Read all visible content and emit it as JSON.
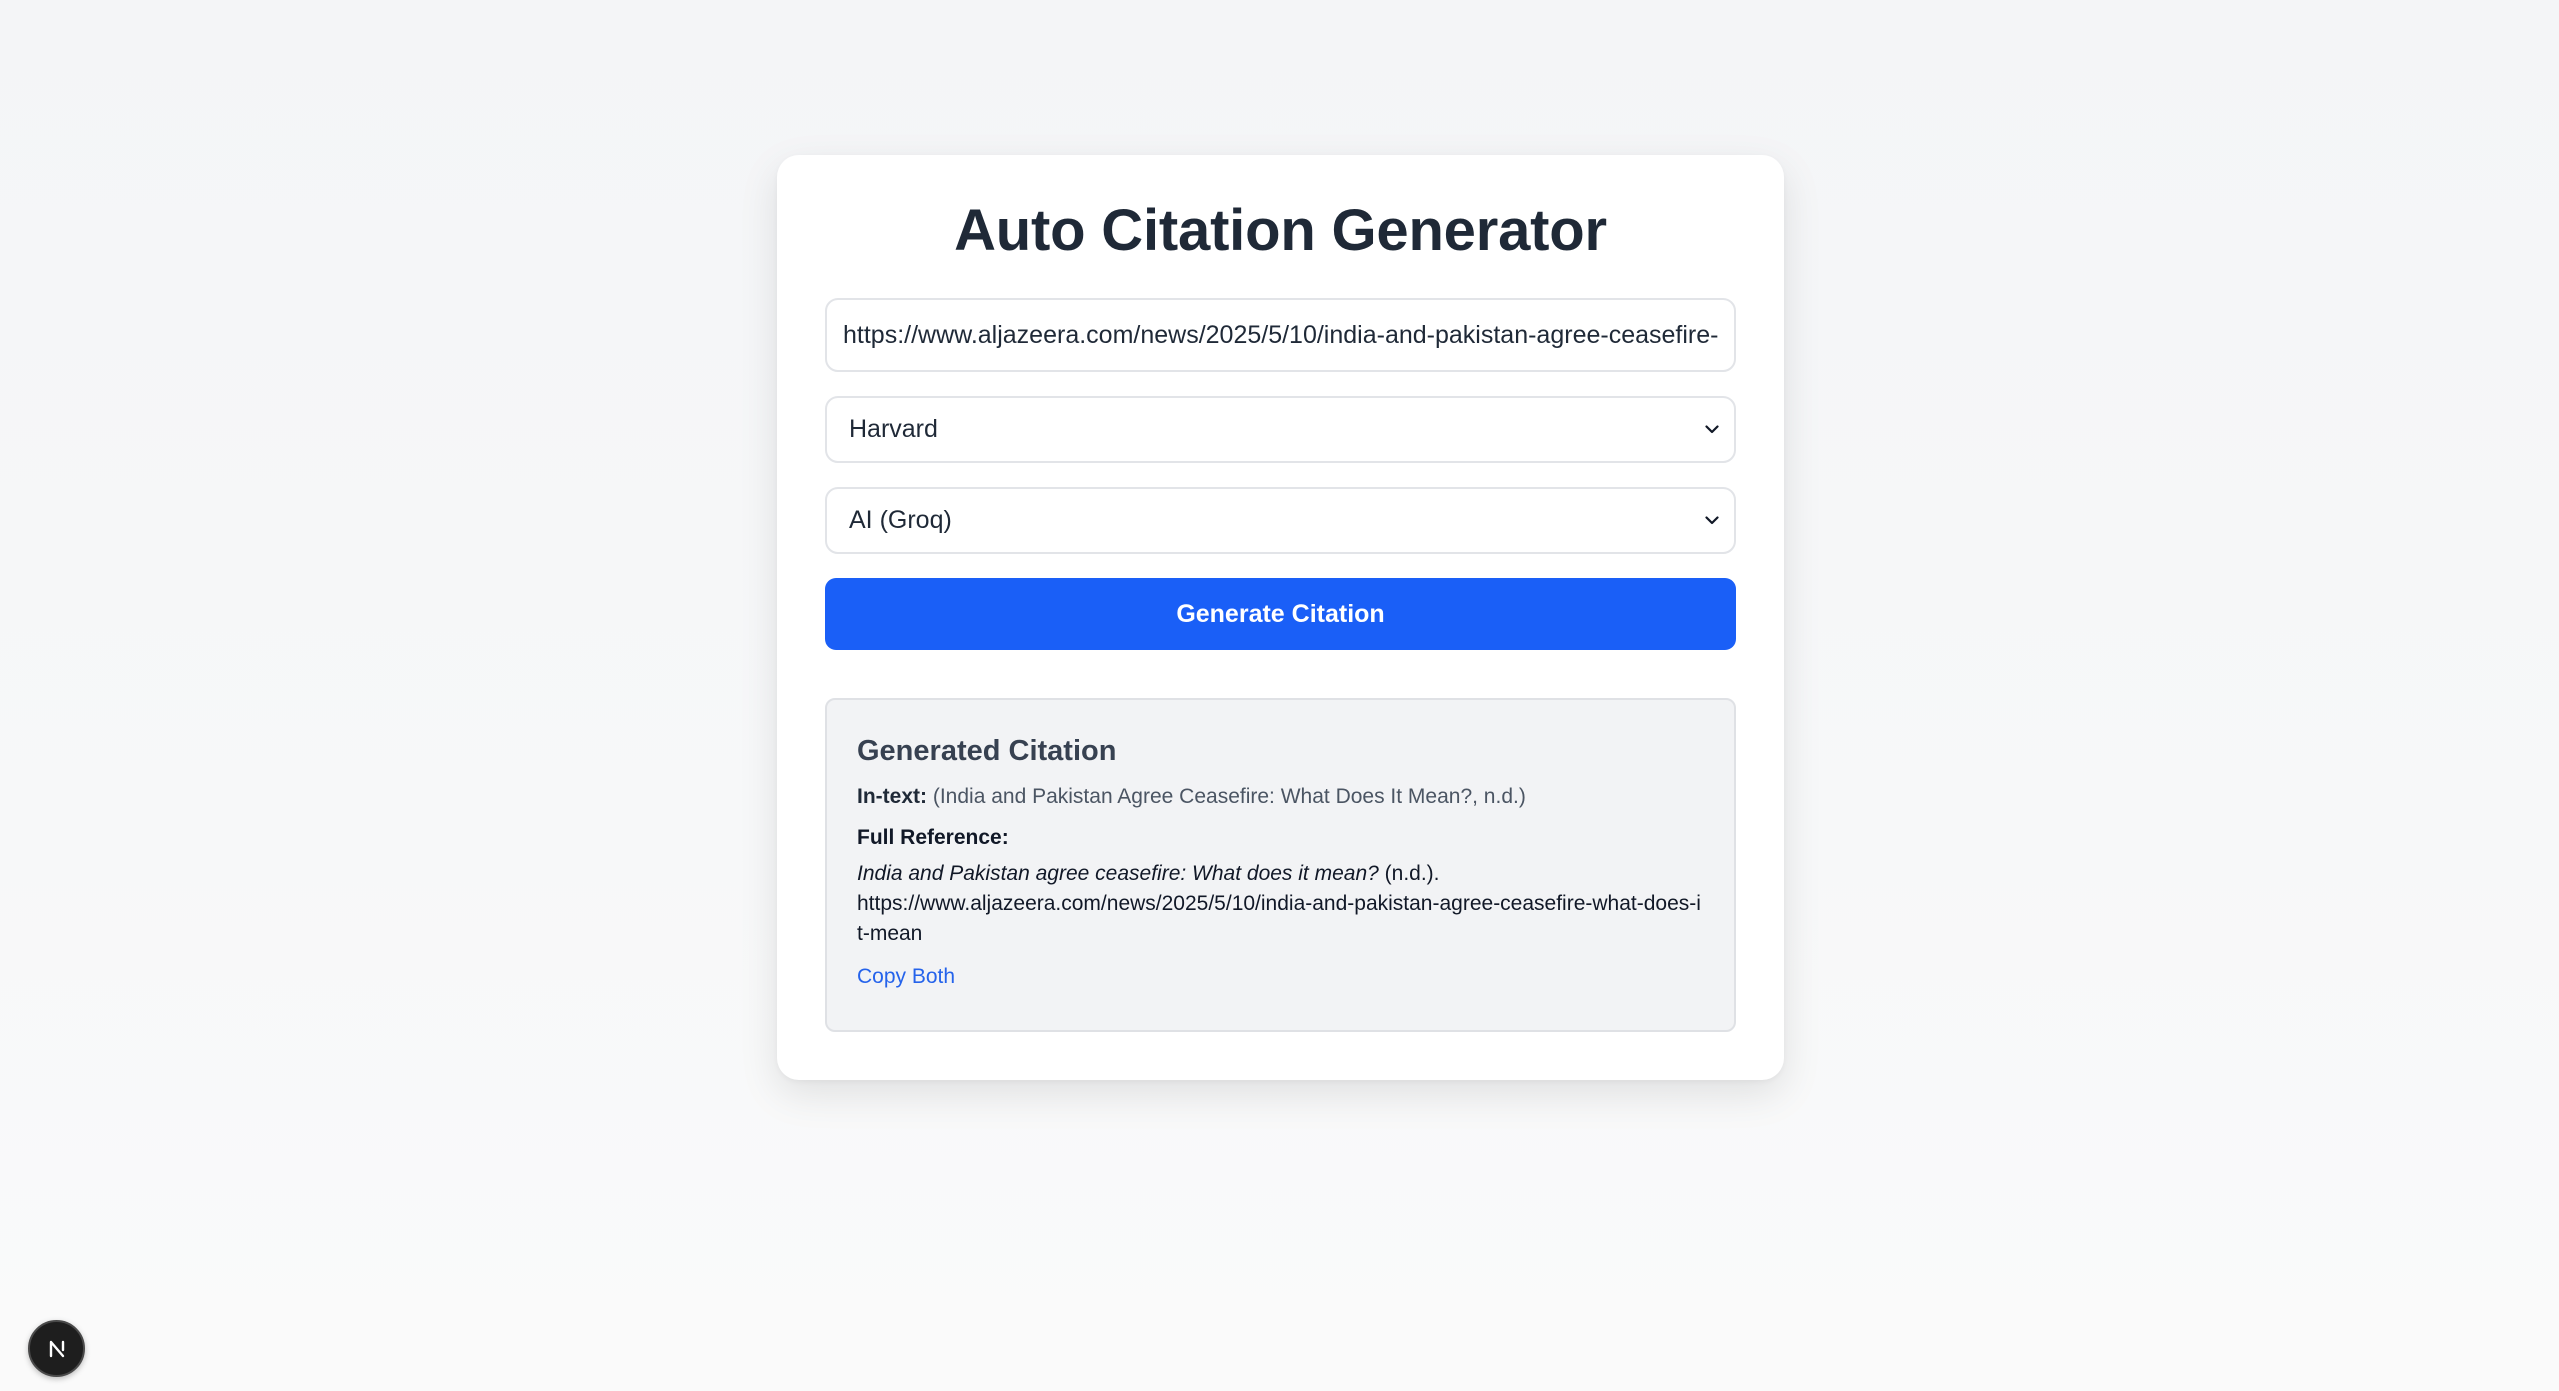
{
  "app": {
    "title": "Auto Citation Generator"
  },
  "form": {
    "url_value": "https://www.aljazeera.com/news/2025/5/10/india-and-pakistan-agree-ceasefire-what-does-it-mean",
    "citation_style": "Harvard",
    "engine": "AI (Groq)",
    "generate_label": "Generate Citation"
  },
  "result": {
    "heading": "Generated Citation",
    "intext_label": "In-text:",
    "intext_value": "(India and Pakistan Agree Ceasefire: What Does It Mean?, n.d.)",
    "full_label": "Full Reference:",
    "full_title": "India and Pakistan agree ceasefire: What does it mean?",
    "full_date": "(n.d.).",
    "full_url": "https://www.aljazeera.com/news/2025/5/10/india-and-pakistan-agree-ceasefire-what-does-it-mean",
    "copy_label": "Copy Both"
  },
  "badge": {
    "letter": "N"
  },
  "icons": {
    "dropdown": "chevron-down-icon",
    "badge": "nextjs-logo-icon"
  },
  "colors": {
    "accent": "#1a5ff7",
    "link": "#2563eb",
    "heading": "#1f2937",
    "result_bg": "#f2f3f5"
  }
}
